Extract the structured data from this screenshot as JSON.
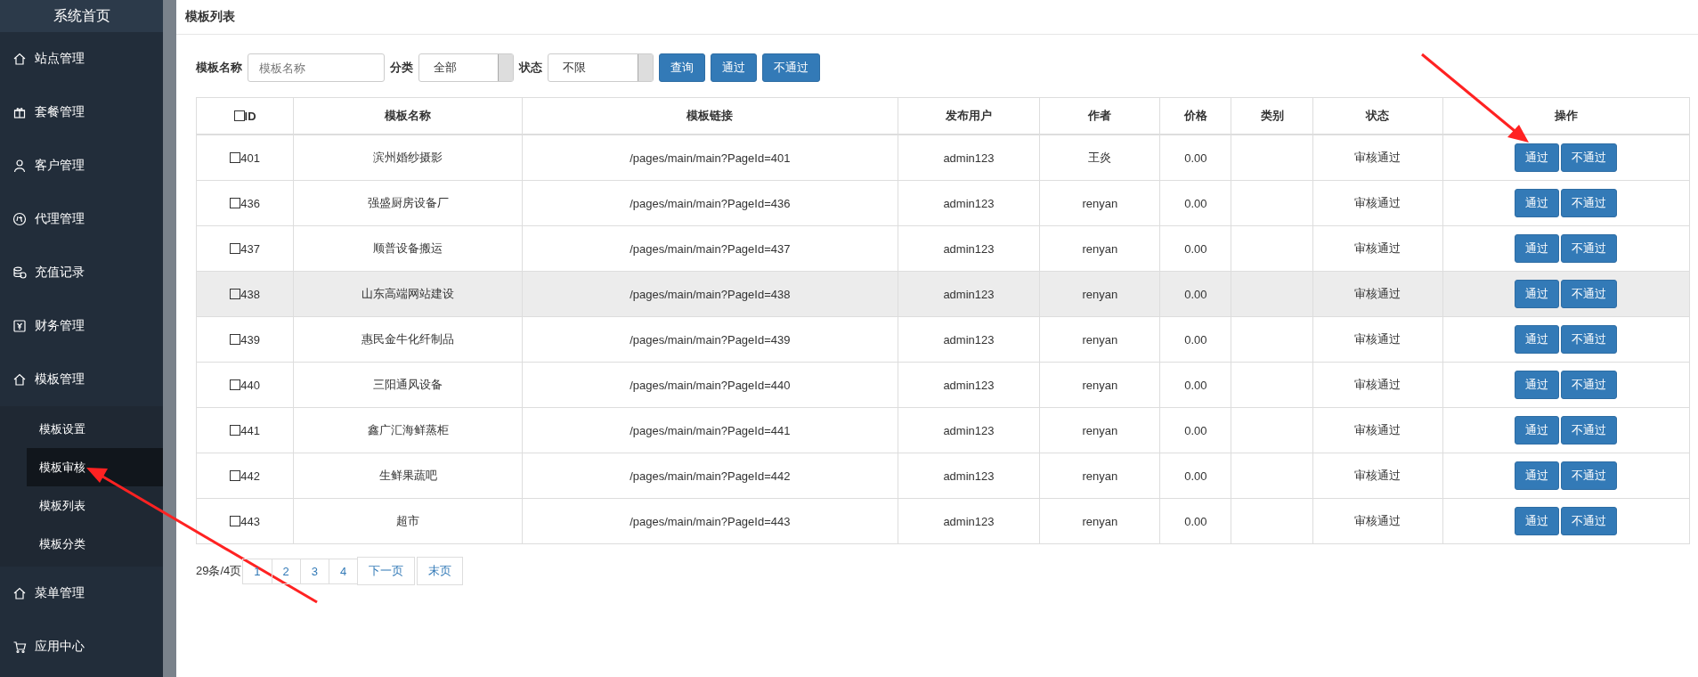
{
  "sidebar": {
    "title": "系统首页",
    "items": [
      {
        "label": "站点管理"
      },
      {
        "label": "套餐管理"
      },
      {
        "label": "客户管理"
      },
      {
        "label": "代理管理"
      },
      {
        "label": "充值记录"
      },
      {
        "label": "财务管理"
      },
      {
        "label": "模板管理",
        "children": [
          {
            "label": "模板设置",
            "selected": false
          },
          {
            "label": "模板审核",
            "selected": true
          },
          {
            "label": "模板列表",
            "selected": false
          },
          {
            "label": "模板分类",
            "selected": false
          }
        ]
      },
      {
        "label": "菜单管理"
      },
      {
        "label": "应用中心"
      }
    ]
  },
  "page_title": "模板列表",
  "filters": {
    "name_label": "模板名称",
    "name_placeholder": "模板名称",
    "category_label": "分类",
    "category_value": "全部",
    "status_label": "状态",
    "status_value": "不限",
    "buttons": [
      "查询",
      "通过",
      "不通过"
    ]
  },
  "table": {
    "header_checked": false,
    "columns": [
      "ID",
      "模板名称",
      "模板链接",
      "发布用户",
      "作者",
      "价格",
      "类别",
      "状态",
      "操作"
    ],
    "rows": [
      {
        "id": "401",
        "name": "滨州婚纱摄影",
        "link": "/pages/main/main?PageId=401",
        "user": "admin123",
        "author": "王炎",
        "price": "0.00",
        "category": "",
        "status": "审核通过",
        "actions": [
          "通过",
          "不通过"
        ],
        "checked": false,
        "highlighted": false
      },
      {
        "id": "436",
        "name": "强盛厨房设备厂",
        "link": "/pages/main/main?PageId=436",
        "user": "admin123",
        "author": "renyan",
        "price": "0.00",
        "category": "",
        "status": "审核通过",
        "actions": [
          "通过",
          "不通过"
        ],
        "checked": false,
        "highlighted": false
      },
      {
        "id": "437",
        "name": "顺普设备搬运",
        "link": "/pages/main/main?PageId=437",
        "user": "admin123",
        "author": "renyan",
        "price": "0.00",
        "category": "",
        "status": "审核通过",
        "actions": [
          "通过",
          "不通过"
        ],
        "checked": false,
        "highlighted": false
      },
      {
        "id": "438",
        "name": "山东高端网站建设",
        "link": "/pages/main/main?PageId=438",
        "user": "admin123",
        "author": "renyan",
        "price": "0.00",
        "category": "",
        "status": "审核通过",
        "actions": [
          "通过",
          "不通过"
        ],
        "checked": false,
        "highlighted": true
      },
      {
        "id": "439",
        "name": "惠民金牛化纤制品",
        "link": "/pages/main/main?PageId=439",
        "user": "admin123",
        "author": "renyan",
        "price": "0.00",
        "category": "",
        "status": "审核通过",
        "actions": [
          "通过",
          "不通过"
        ],
        "checked": false,
        "highlighted": false
      },
      {
        "id": "440",
        "name": "三阳通风设备",
        "link": "/pages/main/main?PageId=440",
        "user": "admin123",
        "author": "renyan",
        "price": "0.00",
        "category": "",
        "status": "审核通过",
        "actions": [
          "通过",
          "不通过"
        ],
        "checked": false,
        "highlighted": false
      },
      {
        "id": "441",
        "name": "鑫广汇海鲜蒸柜",
        "link": "/pages/main/main?PageId=441",
        "user": "admin123",
        "author": "renyan",
        "price": "0.00",
        "category": "",
        "status": "审核通过",
        "actions": [
          "通过",
          "不通过"
        ],
        "checked": false,
        "highlighted": false
      },
      {
        "id": "442",
        "name": "生鲜果蔬吧",
        "link": "/pages/main/main?PageId=442",
        "user": "admin123",
        "author": "renyan",
        "price": "0.00",
        "category": "",
        "status": "审核通过",
        "actions": [
          "通过",
          "不通过"
        ],
        "checked": false,
        "highlighted": false
      },
      {
        "id": "443",
        "name": "超市",
        "link": "/pages/main/main?PageId=443",
        "user": "admin123",
        "author": "renyan",
        "price": "0.00",
        "category": "",
        "status": "审核通过",
        "actions": [
          "通过",
          "不通过"
        ],
        "checked": false,
        "highlighted": false
      }
    ]
  },
  "pagination": {
    "summary": "29条/4页",
    "pages": [
      "1",
      "2",
      "3",
      "4"
    ],
    "next": "下一页",
    "last": "末页"
  }
}
